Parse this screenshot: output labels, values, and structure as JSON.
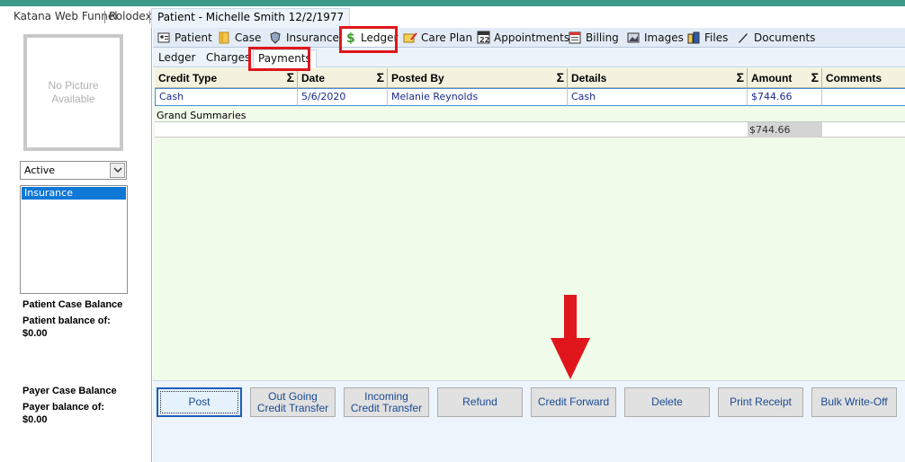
{
  "window_tabs": [
    {
      "label": "Katana Web Funnel"
    },
    {
      "label": "Rolodex"
    },
    {
      "label": "Patient - Michelle Smith 12/2/1977"
    }
  ],
  "left_panel": {
    "photo_placeholder_line1": "No Picture",
    "photo_placeholder_line2": "Available",
    "status_value": "Active",
    "cases": [
      "Insurance"
    ],
    "patient_balance_title": "Patient Case Balance",
    "patient_balance_label": "Patient balance of:",
    "patient_balance_value": "$0.00",
    "payer_balance_title": "Payer Case Balance",
    "payer_balance_label": "Payer balance of:",
    "payer_balance_value": "$0.00"
  },
  "nav_tabs": [
    {
      "label": "Patient",
      "icon": "patient-icon"
    },
    {
      "label": "Case",
      "icon": "case-folder-icon"
    },
    {
      "label": "Insurance",
      "icon": "insurance-shield-icon"
    },
    {
      "label": "Ledger",
      "icon": "dollar-icon"
    },
    {
      "label": "Care Plan",
      "icon": "care-plan-icon"
    },
    {
      "label": "Appointments",
      "icon": "calendar-icon"
    },
    {
      "label": "Billing",
      "icon": "billing-icon"
    },
    {
      "label": "Images",
      "icon": "images-icon"
    },
    {
      "label": "Files",
      "icon": "files-icon"
    },
    {
      "label": "Documents",
      "icon": "pen-icon"
    }
  ],
  "sub_tabs": [
    {
      "label": "Ledger"
    },
    {
      "label": "Charges"
    },
    {
      "label": "Payments"
    }
  ],
  "grid": {
    "columns": [
      "Credit Type",
      "Date",
      "Posted By",
      "Details",
      "Amount",
      "Comments"
    ],
    "rows": [
      [
        "Cash",
        "5/6/2020",
        "Melanie Reynolds",
        "Cash",
        "$744.66",
        ""
      ]
    ],
    "summary_label": "Grand Summaries",
    "summary_amount": "$744.66"
  },
  "actions": {
    "post": "Post",
    "out_going_line1": "Out Going",
    "out_going_line2": "Credit Transfer",
    "incoming_line1": "Incoming",
    "incoming_line2": "Credit Transfer",
    "refund": "Refund",
    "credit_forward": "Credit Forward",
    "delete": "Delete",
    "print_receipt": "Print Receipt",
    "bulk_write_off": "Bulk Write-Off"
  },
  "colors": {
    "accent_teal": "#3e9b8a",
    "highlight_red": "#e0161c",
    "selection_blue": "#0f78d7"
  }
}
